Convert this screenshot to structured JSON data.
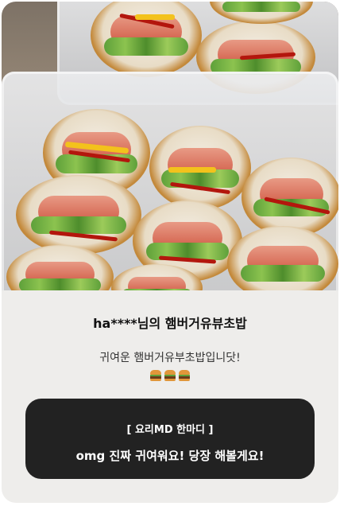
{
  "photo": {
    "alt_subject": "food-photo",
    "colors": {
      "tofu_skin": "#c48a3c",
      "sausage": "#d86f5a",
      "lettuce": "#5ea03a",
      "ketchup": "#b3160d",
      "cheese": "#f3c21c"
    }
  },
  "review": {
    "title": "ha****님의 햄버거유뷰초밥",
    "body": "귀여운 햄버거유부초밥입니닷!",
    "emoji_count": 3,
    "emoji_icon": "hamburger-icon"
  },
  "md_comment": {
    "label": "[ 요리MD 한마디 ]",
    "text": "omg 진짜 귀여워요! 당장 해볼게요!",
    "background": "#222222",
    "text_color": "#ffffff"
  },
  "colors": {
    "card_bg": "#eeedeb",
    "title": "#111111",
    "body": "#333333"
  }
}
